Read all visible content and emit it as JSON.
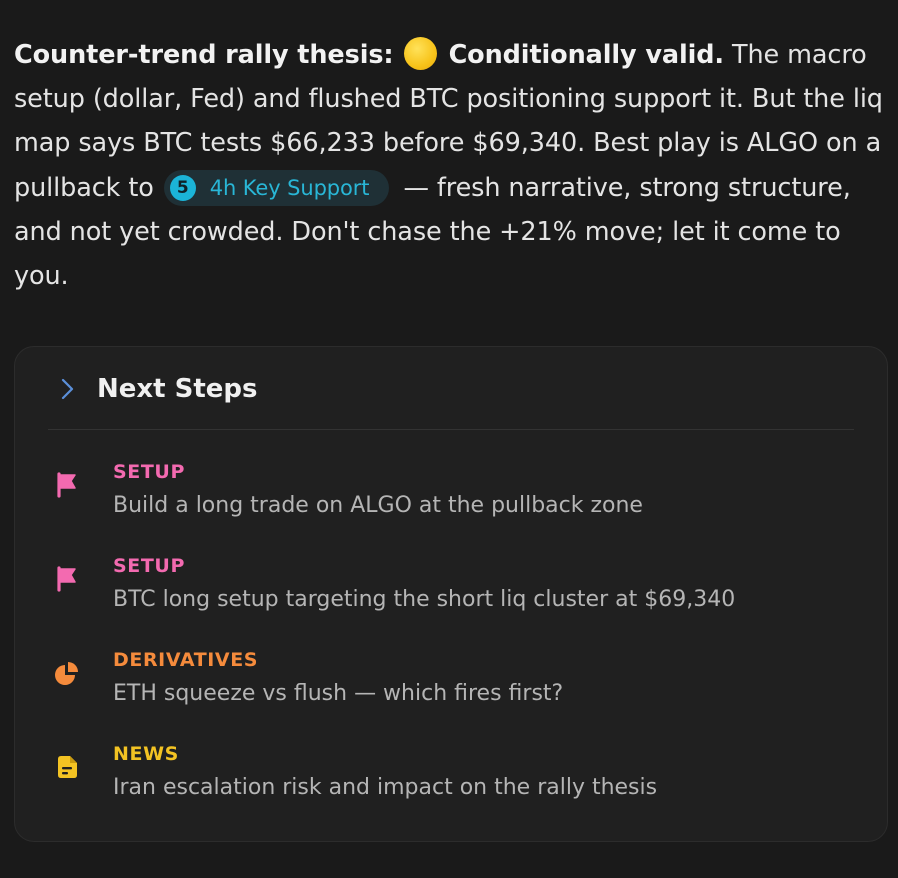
{
  "message": {
    "lead_bold": "Counter-trend rally thesis:",
    "emoji": "yellow-circle",
    "verdict_bold": "Conditionally valid.",
    "text_part1": " The macro setup (dollar, Fed) and flushed BTC positioning support it. But the liq map says BTC tests $66,233 before $69,340. Best play is ALGO on a pullback to ",
    "chip": {
      "number": "5",
      "label": "4h Key Support"
    },
    "text_part2": " — fresh narrative, strong structure, and not yet crowded. Don't chase the +21% move; let it come to you."
  },
  "next_steps": {
    "title": "Next Steps",
    "items": [
      {
        "category": "SETUP",
        "text": "Build a long trade on ALGO at the pullback zone",
        "icon": "flag-icon",
        "color": "#f36ab0"
      },
      {
        "category": "SETUP",
        "text": "BTC long setup targeting the short liq cluster at $69,340",
        "icon": "flag-icon",
        "color": "#f36ab0"
      },
      {
        "category": "DERIVATIVES",
        "text": "ETH squeeze vs flush — which fires first?",
        "icon": "pie-chart-icon",
        "color": "#f58b3c"
      },
      {
        "category": "NEWS",
        "text": "Iran escalation risk and impact on the rally thesis",
        "icon": "news-document-icon",
        "color": "#f3c323"
      }
    ]
  },
  "colors": {
    "background": "#1a1a1a",
    "card": "#202020",
    "chip_bg": "#1f3036",
    "chip_accent": "#1bb4d8",
    "chevron": "#5b8fd9"
  }
}
